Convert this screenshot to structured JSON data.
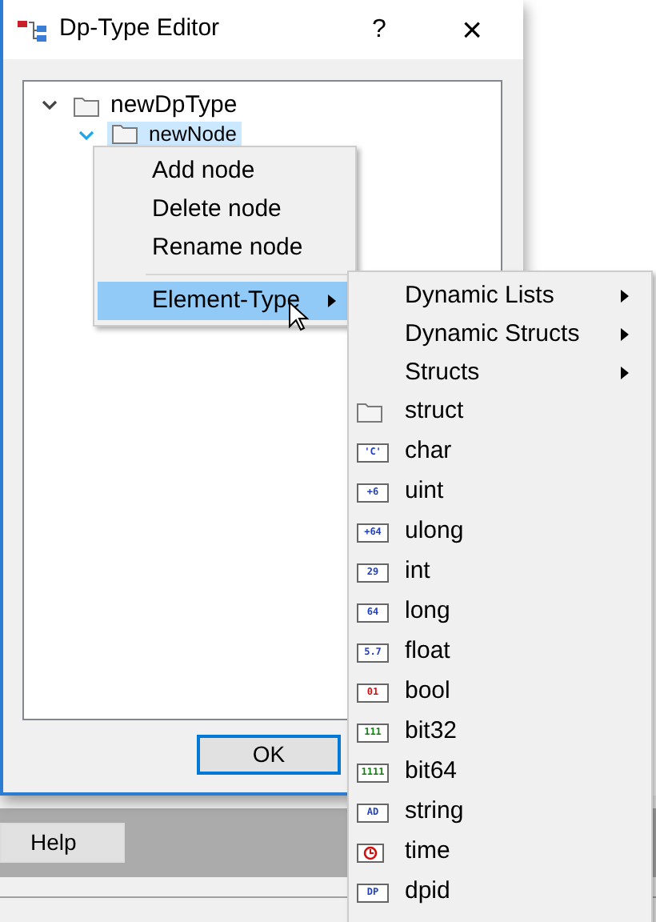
{
  "window": {
    "title": "Dp-Type Editor",
    "help": "?",
    "close": "×"
  },
  "tree": [
    {
      "label": "newDpType",
      "expanded": true,
      "selected": false,
      "children": [
        {
          "label": "newNode",
          "expanded": true,
          "selected": true
        }
      ]
    }
  ],
  "dialog_buttons": [
    "OK"
  ],
  "background_buttons": [
    "Help"
  ],
  "context_menu": [
    {
      "label": "Add node",
      "selected": false,
      "has_submenu": false
    },
    {
      "label": "Delete node",
      "selected": false,
      "has_submenu": false
    },
    {
      "label": "Rename node",
      "selected": false,
      "has_submenu": false
    },
    {
      "label": "Element-Type",
      "selected": true,
      "has_submenu": true
    }
  ],
  "submenu": [
    {
      "kind": "submenu",
      "label": "Dynamic Lists"
    },
    {
      "kind": "submenu",
      "label": "Dynamic Structs"
    },
    {
      "kind": "submenu",
      "label": "Structs"
    },
    {
      "kind": "folder",
      "label": "struct"
    },
    {
      "kind": "badge",
      "label": "char",
      "icon_text": "'C'",
      "color": "#1f3fbf"
    },
    {
      "kind": "badge",
      "label": "uint",
      "icon_text": "+6",
      "color": "#1f3fbf"
    },
    {
      "kind": "badge",
      "label": "ulong",
      "icon_text": "+64",
      "color": "#1f3fbf"
    },
    {
      "kind": "badge",
      "label": "int",
      "icon_text": "29",
      "color": "#1f3fbf"
    },
    {
      "kind": "badge",
      "label": "long",
      "icon_text": "64",
      "color": "#1f3fbf"
    },
    {
      "kind": "badge",
      "label": "float",
      "icon_text": "5.7",
      "color": "#1f3fbf"
    },
    {
      "kind": "badge",
      "label": "bool",
      "icon_text": "01",
      "color": "#d01010"
    },
    {
      "kind": "badge",
      "label": "bit32",
      "icon_text": "111",
      "color": "#108010"
    },
    {
      "kind": "badge",
      "label": "bit64",
      "icon_text": "1111",
      "color": "#108010"
    },
    {
      "kind": "badge",
      "label": "string",
      "icon_text": "AD",
      "color": "#1f3fbf"
    },
    {
      "kind": "clock",
      "label": "time"
    },
    {
      "kind": "badge",
      "label": "dpid",
      "icon_text": "DP",
      "color": "#1f3fbf"
    }
  ]
}
